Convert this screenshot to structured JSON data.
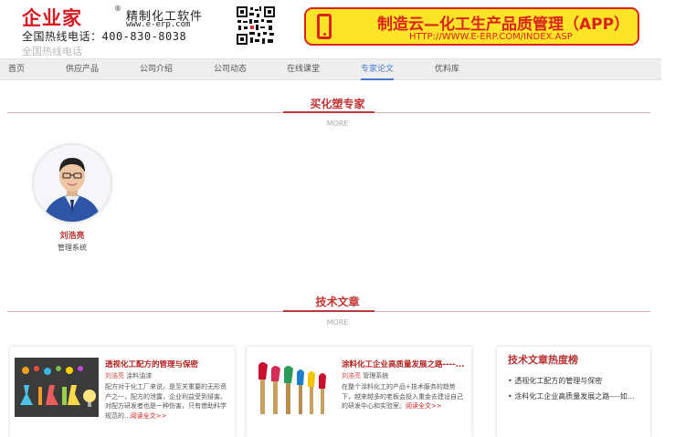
{
  "header": {
    "logo_text": "企业家",
    "logo_reg": "®",
    "company_name": "精制化工软件",
    "company_site": "www.e-erp.com",
    "hotline": "全国热线电话：400-830-8038",
    "hotline_faint": "全国热线电话"
  },
  "banner": {
    "title": "制造云—化工生产品质管理（APP）",
    "url": "HTTP://WWW.E-ERP.COM/INDEX.ASP"
  },
  "nav": {
    "items": [
      {
        "label": "首页"
      },
      {
        "label": "供应产品"
      },
      {
        "label": "公司介绍"
      },
      {
        "label": "公司动态"
      },
      {
        "label": "在线课堂"
      },
      {
        "label": "专家论文"
      },
      {
        "label": "优料库"
      }
    ],
    "active_index": 5
  },
  "experts_section": {
    "title": "买化塑专家",
    "more": "MORE"
  },
  "expert": {
    "name": "刘浩亮",
    "role": "管理系统"
  },
  "articles_section": {
    "title": "技术文章",
    "more": "MORE"
  },
  "articles": [
    {
      "title": "透视化工配方的管理与保密",
      "author": "刘浩亮",
      "category": "涂料油漆",
      "excerpt": "配方对于化工厂来说，是至关重要的无形资产之一，配方的泄露，企业利益受到侵害。对配方研发者也是一种伤害，只有借助科学规范的...",
      "read_more": "阅读全文>>"
    },
    {
      "title": "涂料化工企业高质量发展之路----...",
      "author": "刘浩亮",
      "category": "管理系统",
      "excerpt": "在整个涂料化工的产品+技术服务的趋势下，越来越多的老板会投入重金去建设自己的研发中心和实验室。",
      "read_more": "阅读全文>>"
    }
  ],
  "hot_list": {
    "title": "技术文章热度榜",
    "items": [
      "• 透视化工配方的管理与保密",
      "• 涂料化工企业高质量发展之路----如..."
    ]
  },
  "colors": {
    "brand_red": "#d6191f",
    "banner_yellow": "#fde428",
    "nav_active": "#4a7bd0",
    "section_red": "#c23232"
  }
}
